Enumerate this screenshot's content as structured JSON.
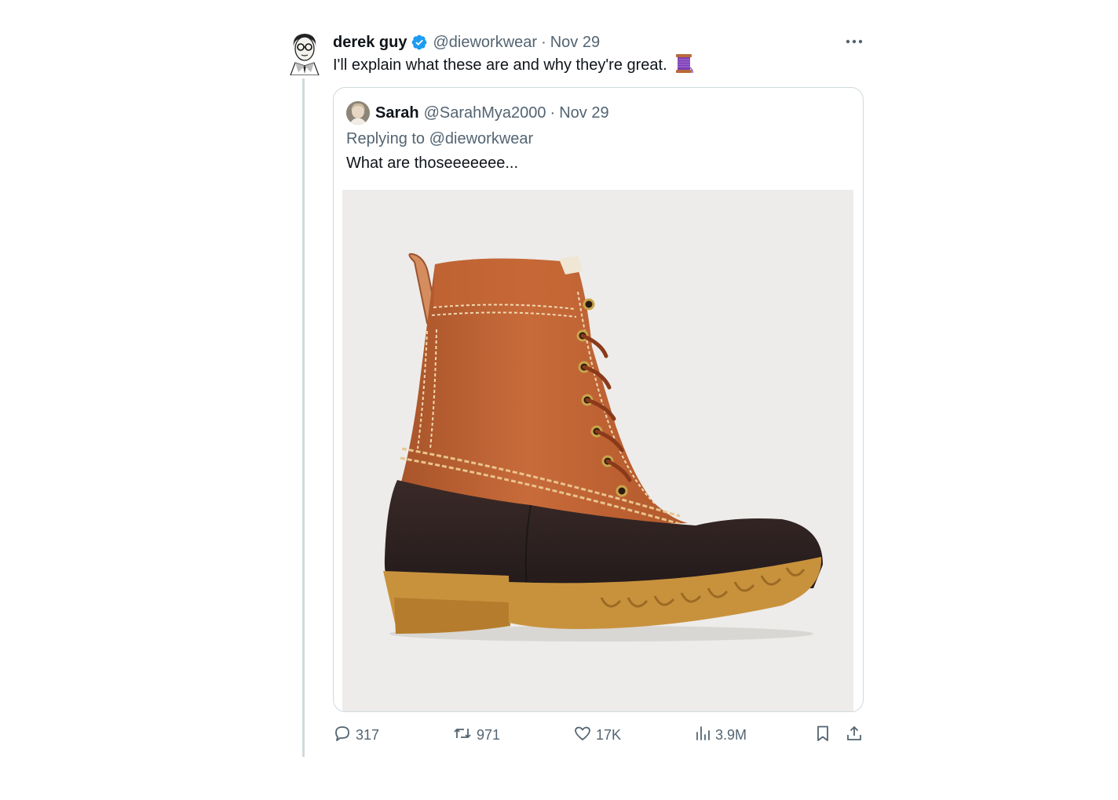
{
  "tweet": {
    "author_name": "derek guy",
    "handle": "@dieworkwear",
    "separator": "·",
    "date": "Nov 29",
    "text": "I'll explain what these are and why they're great.",
    "emoji_icon": "thread-spool-icon",
    "verified_icon": "verified-badge-icon",
    "more_icon": "more-options-icon"
  },
  "quoted": {
    "author_name": "Sarah",
    "handle": "@SarahMya2000",
    "separator": "·",
    "date": "Nov 29",
    "replying_prefix": "Replying to",
    "replying_handle": "@dieworkwear",
    "text": "What are thoseeeeeee...",
    "media_description": "duck-boot-photo"
  },
  "actions": {
    "replies": "317",
    "retweets": "971",
    "likes": "17K",
    "views": "3.9M",
    "icons": [
      "reply-icon",
      "retweet-icon",
      "like-icon",
      "views-icon",
      "bookmark-icon",
      "share-icon"
    ]
  },
  "colors": {
    "text": "#0f1419",
    "muted": "#536471",
    "verified": "#1d9bf0",
    "border": "#cfd9de"
  }
}
